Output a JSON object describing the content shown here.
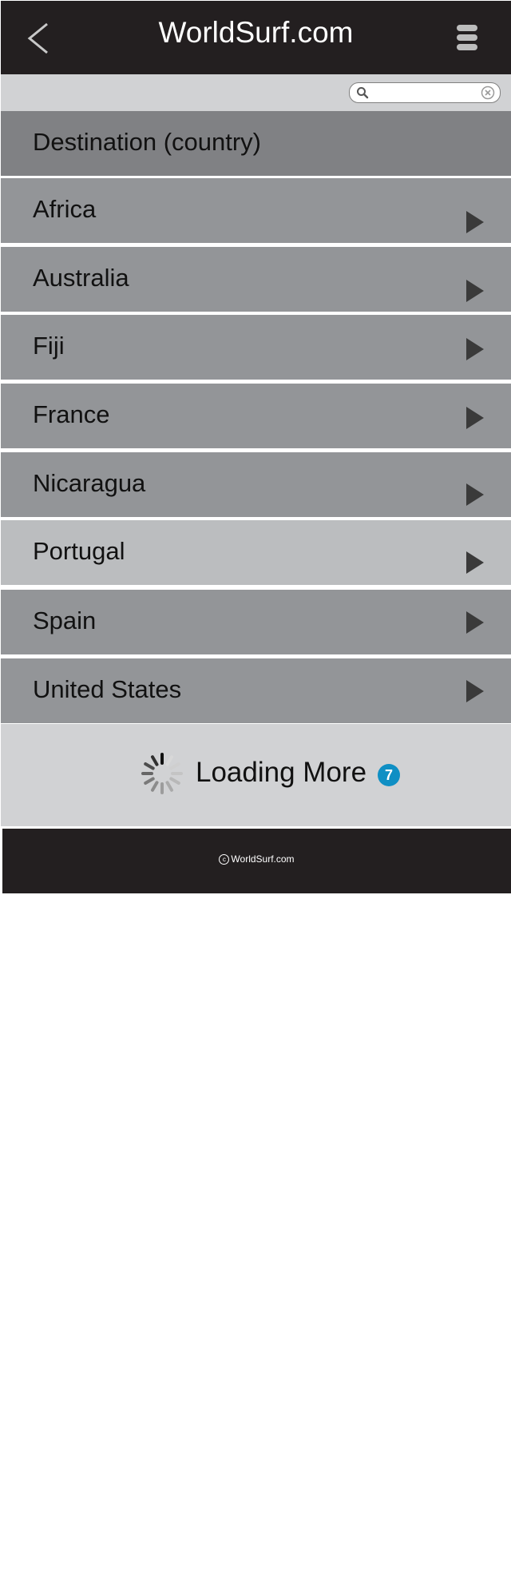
{
  "header": {
    "title": "WorldSurf.com",
    "back_icon": "chevron-left-icon",
    "menu_icon": "hamburger-menu-icon"
  },
  "search": {
    "value": "",
    "placeholder": "",
    "search_icon": "magnifier-icon",
    "clear_icon": "clear-x-icon"
  },
  "list": {
    "header_label": "Destination (country)",
    "items": [
      {
        "label": "Africa"
      },
      {
        "label": "Australia"
      },
      {
        "label": "Fiji"
      },
      {
        "label": "France"
      },
      {
        "label": "Nicaragua"
      },
      {
        "label": "Portugal",
        "selected": true
      },
      {
        "label": "Spain"
      },
      {
        "label": "United States"
      }
    ],
    "arrow_icon": "play-triangle-icon"
  },
  "loading": {
    "label": "Loading More",
    "count": "7",
    "spinner_icon": "spinner-icon"
  },
  "footer": {
    "text": "WorldSurf.com",
    "copyright_symbol": "c"
  },
  "colors": {
    "bar_dark": "#231f20",
    "list_header": "#808184",
    "row": "#939598",
    "row_selected": "#bbbdbf",
    "light_bar": "#d1d2d4",
    "badge": "#0f8fc4"
  }
}
